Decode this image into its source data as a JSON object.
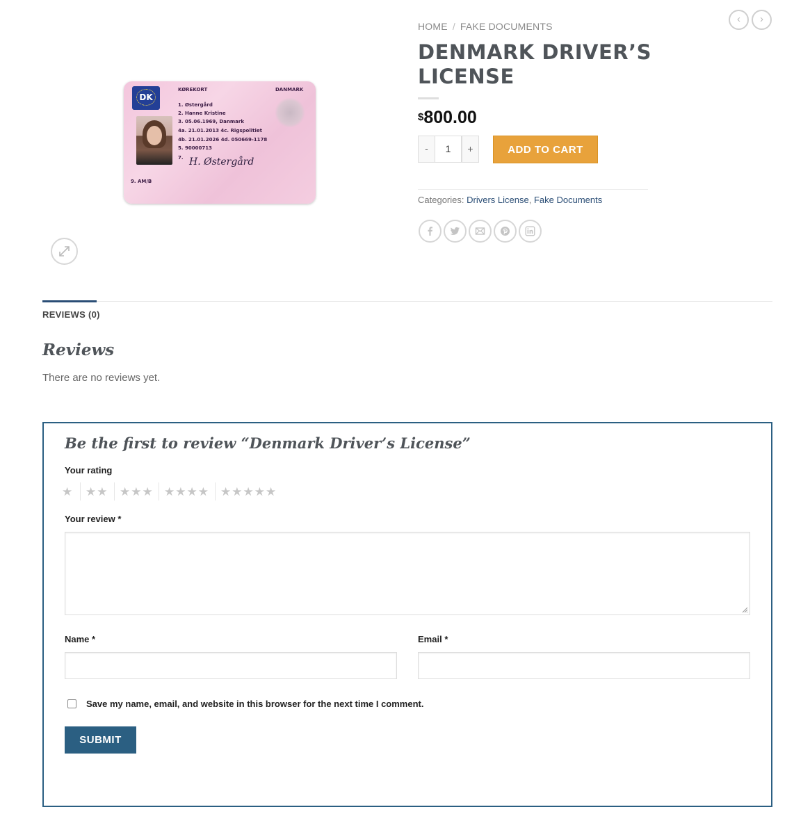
{
  "breadcrumb": {
    "home": "Home",
    "separator": "/",
    "current": "Fake Documents"
  },
  "nav": {
    "prev_icon": "chevron-left-icon",
    "next_icon": "chevron-right-icon",
    "prev_glyph": "‹",
    "next_glyph": "›"
  },
  "product": {
    "title": "Denmark Driver’s License",
    "currency_symbol": "$",
    "price": "800.00",
    "quantity": "1",
    "qty_minus": "-",
    "qty_plus": "+",
    "add_to_cart": "Add to cart",
    "categories_label": "Categories:",
    "categories": [
      "Drivers License",
      "Fake Documents"
    ],
    "category_separator": ","
  },
  "card_image": {
    "header_left": "KØREKORT",
    "header_right": "DANMARK",
    "country_code": "DK",
    "fields": [
      "1.   Østergård",
      "2.   Hanne Kristine",
      "3.   05.06.1969, Danmark",
      "4a. 21.01.2013    4c. Rigspolitiet",
      "4b. 21.01.2026    4d. 050669-1178",
      "5.   90000713",
      "7."
    ],
    "signature": "H. Østergård",
    "footer": "9. AM/B"
  },
  "share_icons": [
    "facebook-icon",
    "twitter-icon",
    "email-icon",
    "pinterest-icon",
    "linkedin-icon"
  ],
  "tabs": {
    "reviews_tab": "Reviews (0)"
  },
  "reviews": {
    "heading": "Reviews",
    "empty_text": "There are no reviews yet.",
    "form_title": "Be the first to review “Denmark Driver’s License”",
    "rating_label": "Your rating",
    "rating_options": [
      "★",
      "★★",
      "★★★",
      "★★★★",
      "★★★★★"
    ],
    "review_label": "Your review",
    "required_mark": "*",
    "name_label": "Name",
    "email_label": "Email",
    "save_info_label": "Save my name, email, and website in this browser for the next time I comment.",
    "submit_label": "Submit"
  },
  "colors": {
    "accent": "#2b5f82",
    "cart_button": "#e8a23b",
    "link": "#2b4e76"
  }
}
